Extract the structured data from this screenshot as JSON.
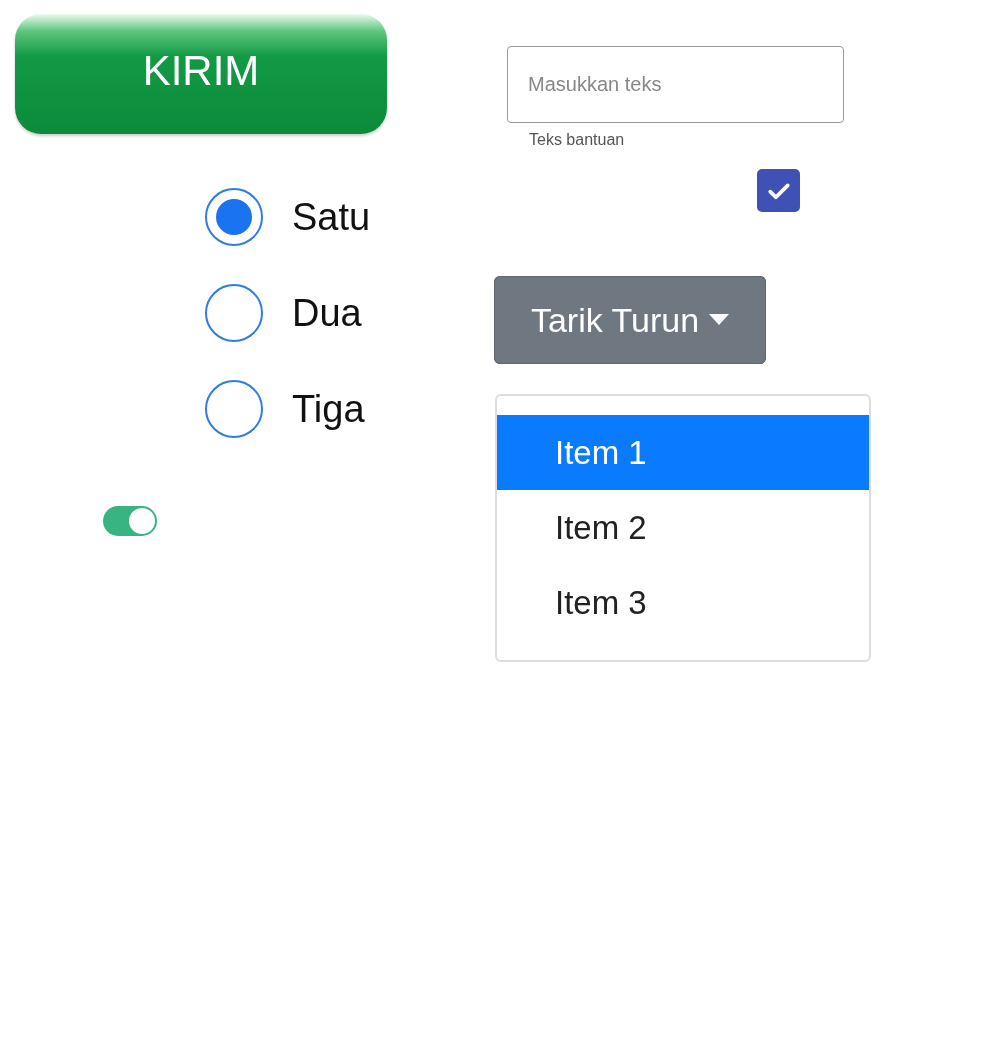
{
  "submit_button": {
    "label": "KIRIM"
  },
  "radios": [
    {
      "label": "Satu",
      "selected": true
    },
    {
      "label": "Dua",
      "selected": false
    },
    {
      "label": "Tiga",
      "selected": false
    }
  ],
  "toggle": {
    "on": true
  },
  "text_field": {
    "placeholder": "Masukkan teks",
    "helper": "Teks bantuan"
  },
  "checkbox": {
    "checked": true
  },
  "dropdown": {
    "label": "Tarik Turun",
    "expanded": true,
    "items": [
      {
        "label": "Item 1",
        "selected": true
      },
      {
        "label": "Item 2",
        "selected": false
      },
      {
        "label": "Item 3",
        "selected": false
      }
    ]
  }
}
